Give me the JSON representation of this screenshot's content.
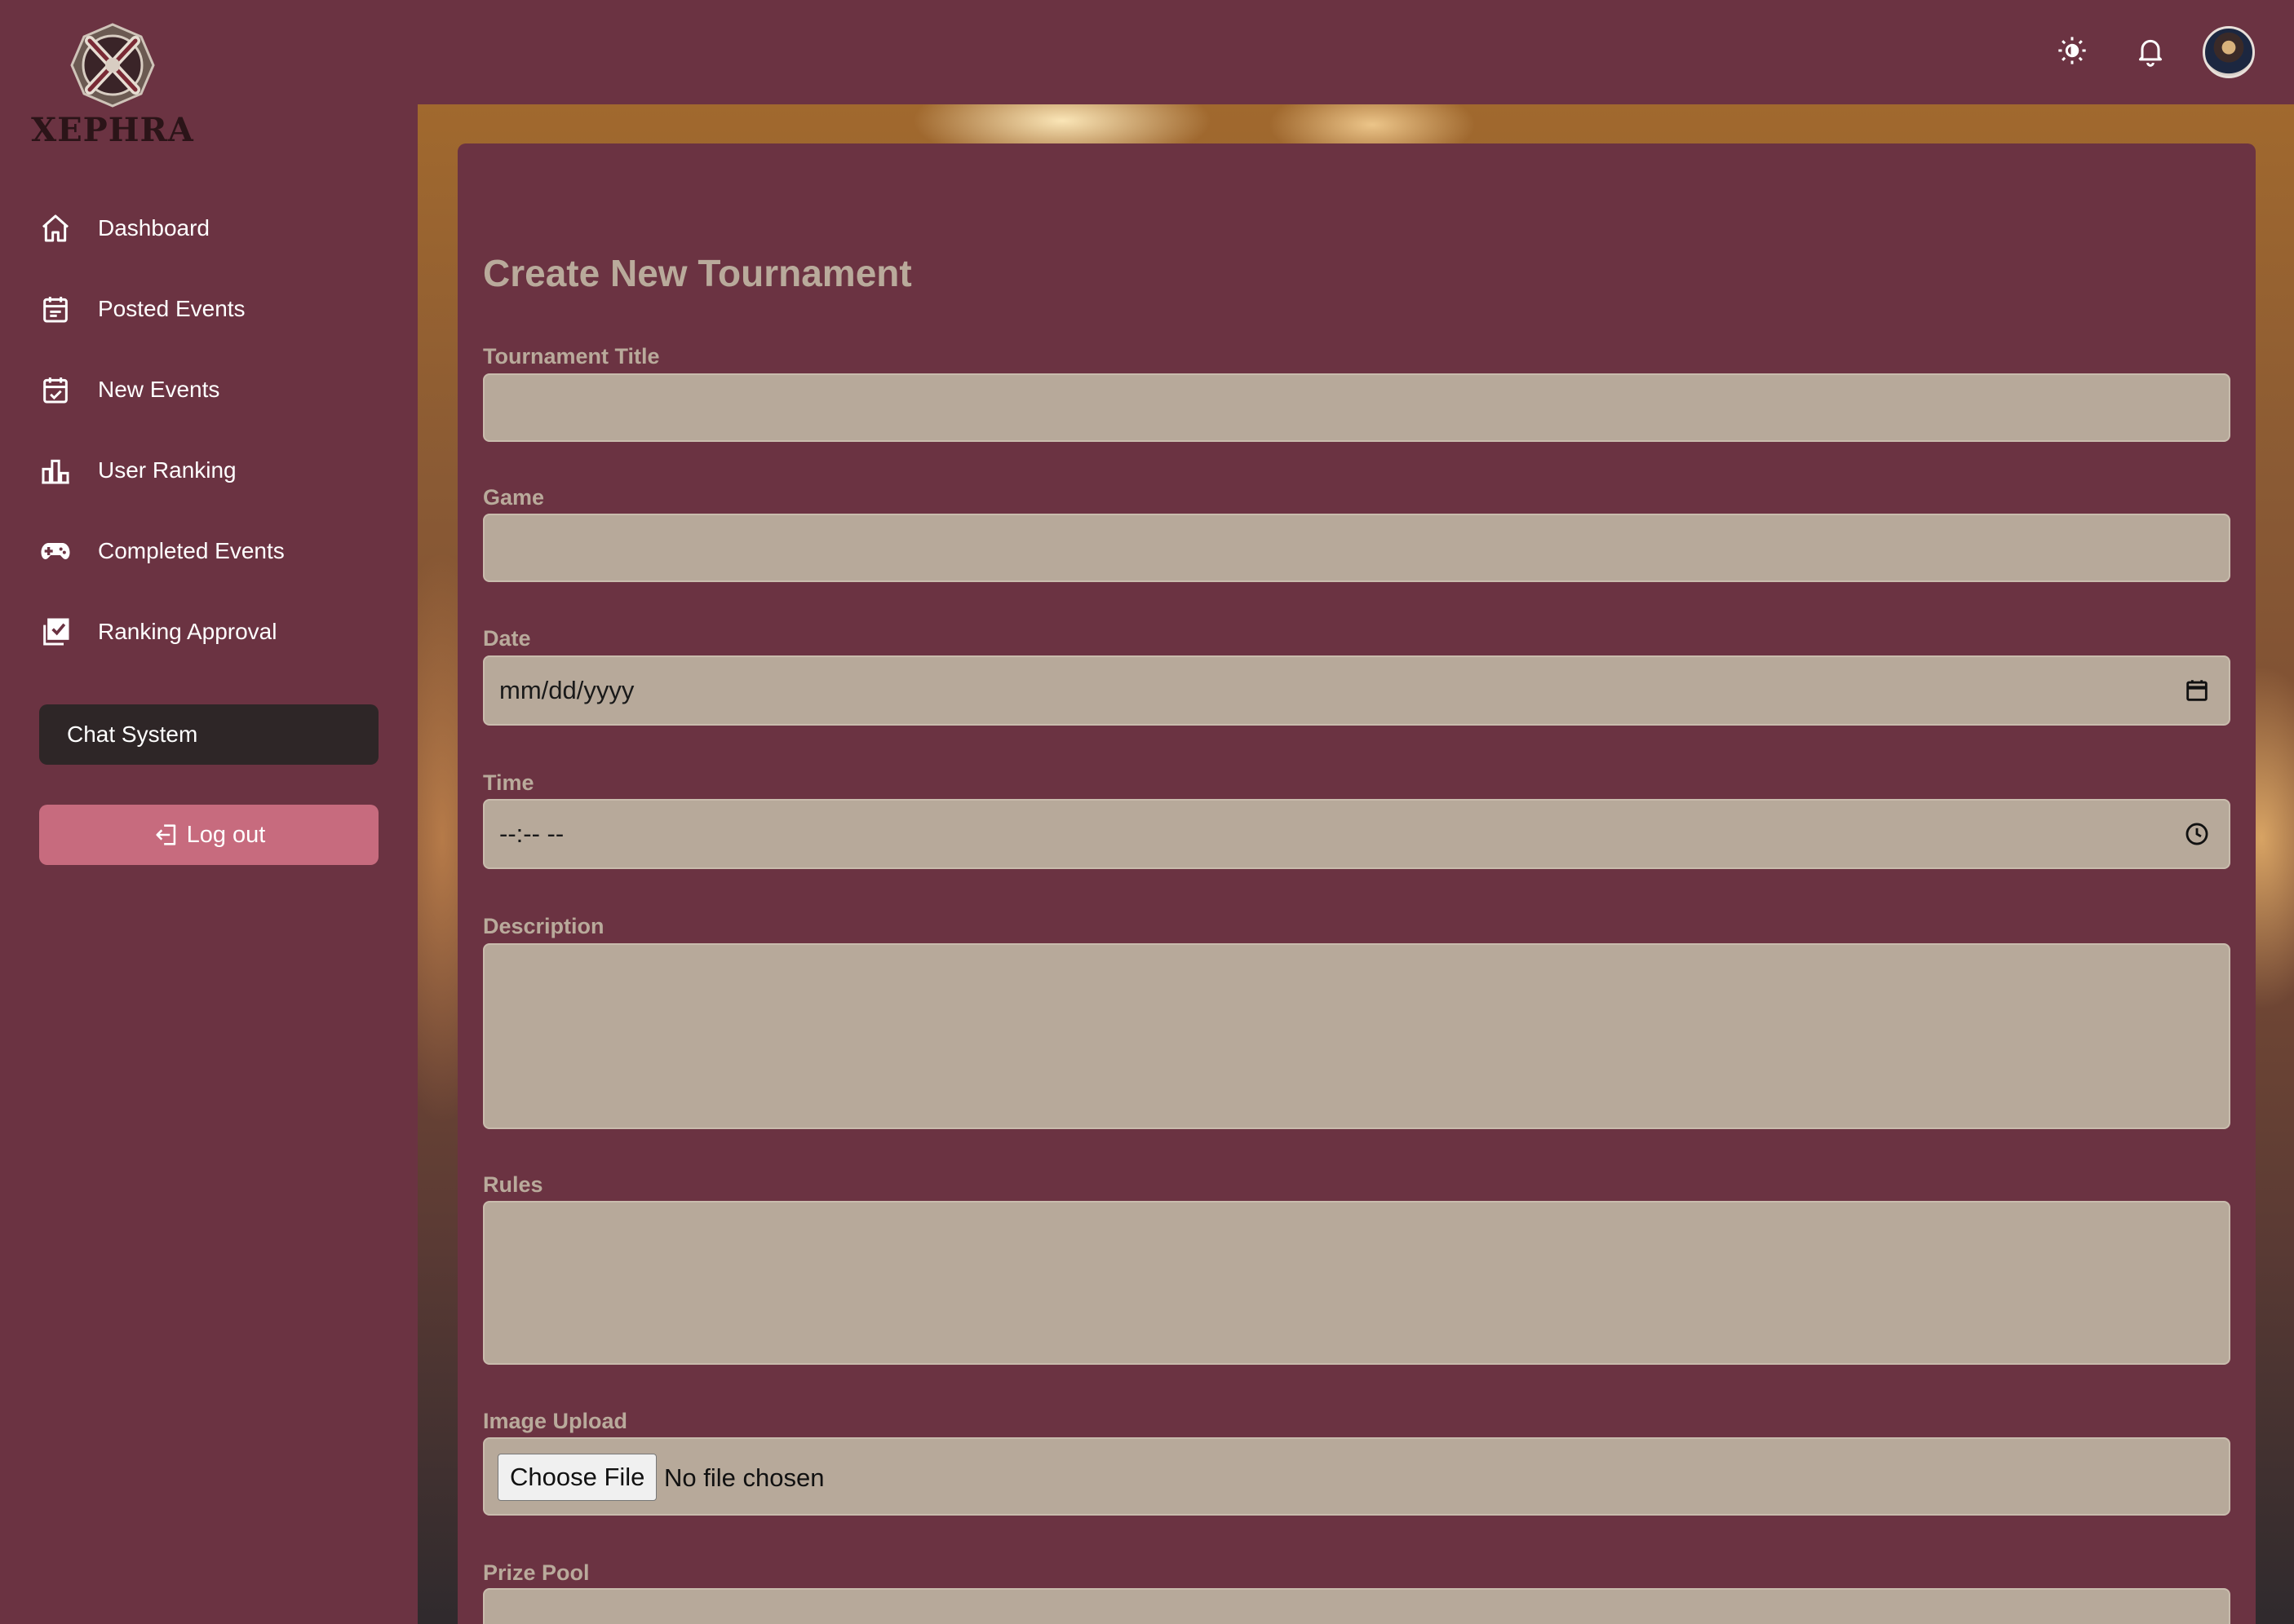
{
  "brand": {
    "logo_text": "XEPHRA"
  },
  "sidebar": {
    "items": [
      {
        "label": "Dashboard",
        "icon": "home-icon"
      },
      {
        "label": "Posted Events",
        "icon": "calendar-icon"
      },
      {
        "label": "New Events",
        "icon": "calendar-check-icon"
      },
      {
        "label": "User Ranking",
        "icon": "ranking-icon"
      },
      {
        "label": "Completed Events",
        "icon": "gamepad-icon"
      },
      {
        "label": "Ranking Approval",
        "icon": "approval-icon"
      }
    ],
    "chat_label": "Chat System",
    "logout_label": "Log out"
  },
  "topbar": {
    "icons": [
      "theme-toggle-icon",
      "bell-icon",
      "avatar"
    ]
  },
  "form": {
    "title": "Create New Tournament",
    "fields": {
      "title": {
        "label": "Tournament Title",
        "value": ""
      },
      "game": {
        "label": "Game",
        "value": ""
      },
      "date": {
        "label": "Date",
        "placeholder": "mm/dd/yyyy"
      },
      "time": {
        "label": "Time",
        "placeholder": "--:-- --"
      },
      "description": {
        "label": "Description",
        "value": ""
      },
      "rules": {
        "label": "Rules",
        "value": ""
      },
      "image": {
        "label": "Image Upload",
        "button": "Choose File",
        "status": "No file chosen"
      },
      "prize": {
        "label": "Prize Pool",
        "value": ""
      }
    }
  },
  "colors": {
    "background": "#6b3342",
    "field": "#b7a99a",
    "label": "#b9aa9b",
    "logout": "#c76b7e",
    "chat": "#2e2627"
  }
}
